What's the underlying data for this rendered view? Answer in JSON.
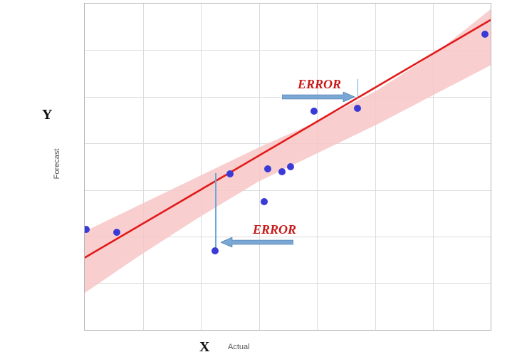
{
  "chart_data": {
    "type": "scatter",
    "title": "",
    "xlabel": "Actual",
    "ylabel": "Forecast",
    "xlab_short": "X",
    "ylab_short": "Y",
    "xlim": [
      0,
      7
    ],
    "ylim": [
      0,
      7
    ],
    "grid": true,
    "series": [
      {
        "name": "points",
        "x": [
          0.02,
          0.55,
          2.25,
          2.5,
          3.1,
          3.15,
          3.4,
          3.55,
          3.95,
          4.7,
          6.9
        ],
        "y": [
          2.15,
          2.1,
          1.7,
          3.35,
          2.75,
          3.45,
          3.4,
          3.5,
          4.7,
          4.75,
          6.35
        ]
      }
    ],
    "fit_line": {
      "x": [
        0,
        7
      ],
      "y": [
        1.55,
        6.65
      ]
    },
    "confidence_band": {
      "x": [
        0,
        1,
        2,
        3,
        4,
        5,
        6,
        7
      ],
      "upper": [
        2.2,
        2.8,
        3.4,
        4.0,
        4.55,
        5.2,
        6.0,
        7.0
      ],
      "lower": [
        0.9,
        1.75,
        2.55,
        3.3,
        3.9,
        4.5,
        5.15,
        5.8
      ]
    },
    "annotations": [
      {
        "text": "ERROR",
        "target_point_index": 9,
        "direction": "right"
      },
      {
        "text": "ERROR",
        "target_point_index": 2,
        "direction": "left"
      }
    ]
  },
  "labels": {
    "x_big": "X",
    "x_small": "Actual",
    "y_big": "Y",
    "y_small": "Forecast",
    "error": "ERROR"
  }
}
